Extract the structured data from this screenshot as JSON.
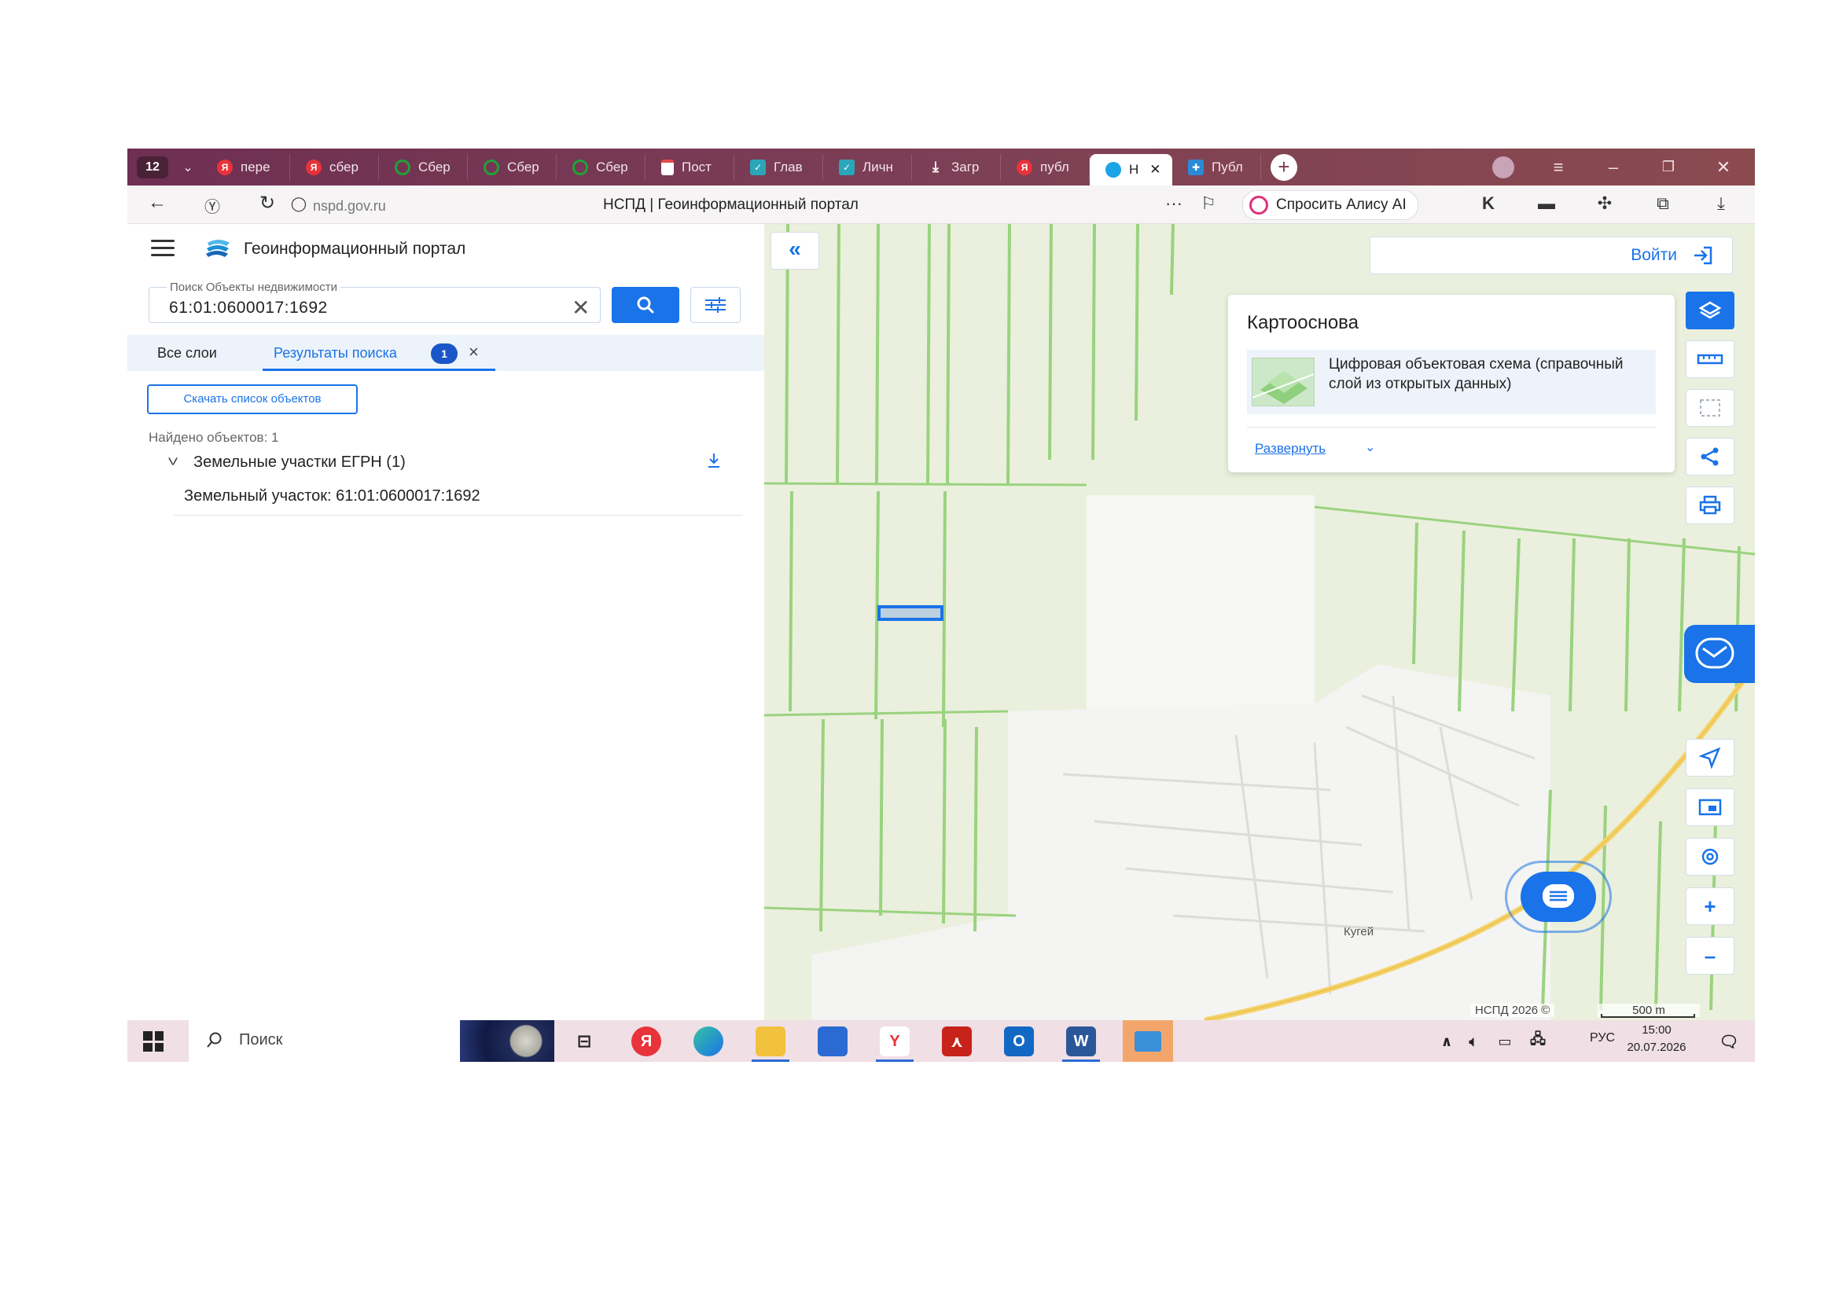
{
  "browser": {
    "tab_count": "12",
    "tabs": [
      {
        "label": "пере",
        "icon": "yandex-icon",
        "color": "#e8333a"
      },
      {
        "label": "сбер",
        "icon": "yandex-icon",
        "color": "#e8333a"
      },
      {
        "label": "Сбер",
        "icon": "sber-icon",
        "color": "#21a038"
      },
      {
        "label": "Сбер",
        "icon": "sber-icon",
        "color": "#21a038"
      },
      {
        "label": "Сбер",
        "icon": "sber-icon",
        "color": "#21a038"
      },
      {
        "label": "Пост",
        "icon": "document-icon",
        "color": "#e34a4a"
      },
      {
        "label": "Глав",
        "icon": "gosuslugi-icon",
        "color": "#2aa6b8"
      },
      {
        "label": "Личн",
        "icon": "gosuslugi-icon",
        "color": "#2aa6b8"
      },
      {
        "label": "Загр",
        "icon": "download-icon",
        "color": "#ffffff"
      },
      {
        "label": "публ",
        "icon": "yandex-icon",
        "color": "#e8333a"
      },
      {
        "label": "Н",
        "icon": "nspd-icon",
        "color": "#1aa5e8",
        "active": true
      },
      {
        "label": "Публ",
        "icon": "map-icon",
        "color": "#2b8ad8"
      }
    ],
    "url": "nspd.gov.ru",
    "page_title": "НСПД | Геоинформационный портал",
    "alice_label": "Спросить Алису AI",
    "more": "···"
  },
  "sidebar": {
    "app_title": "Геоинформационный портал",
    "search": {
      "label": "Поиск Объекты недвижимости",
      "value": "61:01:0600017:1692"
    },
    "tabs": {
      "all_layers": "Все слои",
      "results": "Результаты поиска",
      "results_count": "1"
    },
    "download_list_button": "Скачать список объектов",
    "found_text": "Найдено объектов: 1",
    "group_title": "Земельные участки ЕГРН (1)",
    "result_item": "Земельный участок: 61:01:0600017:1692"
  },
  "map": {
    "login_label": "Войти",
    "basemap": {
      "title": "Картооснова",
      "layer_name": "Цифровая объектовая схема (справочный слой из открытых данных)",
      "expand_link": "Развернуть"
    },
    "place_label": "Кугей",
    "copyright": "НСПД 2026 ©",
    "scale_label": "500 m",
    "colors": {
      "accent": "#1a73e8",
      "field": "#eaf0dd",
      "strip": "#9bd27f",
      "road": "#f4d26a"
    }
  },
  "taskbar": {
    "search_placeholder": "Поиск",
    "lang": "РУС",
    "time": "15:00",
    "date": "20.07.2026"
  }
}
